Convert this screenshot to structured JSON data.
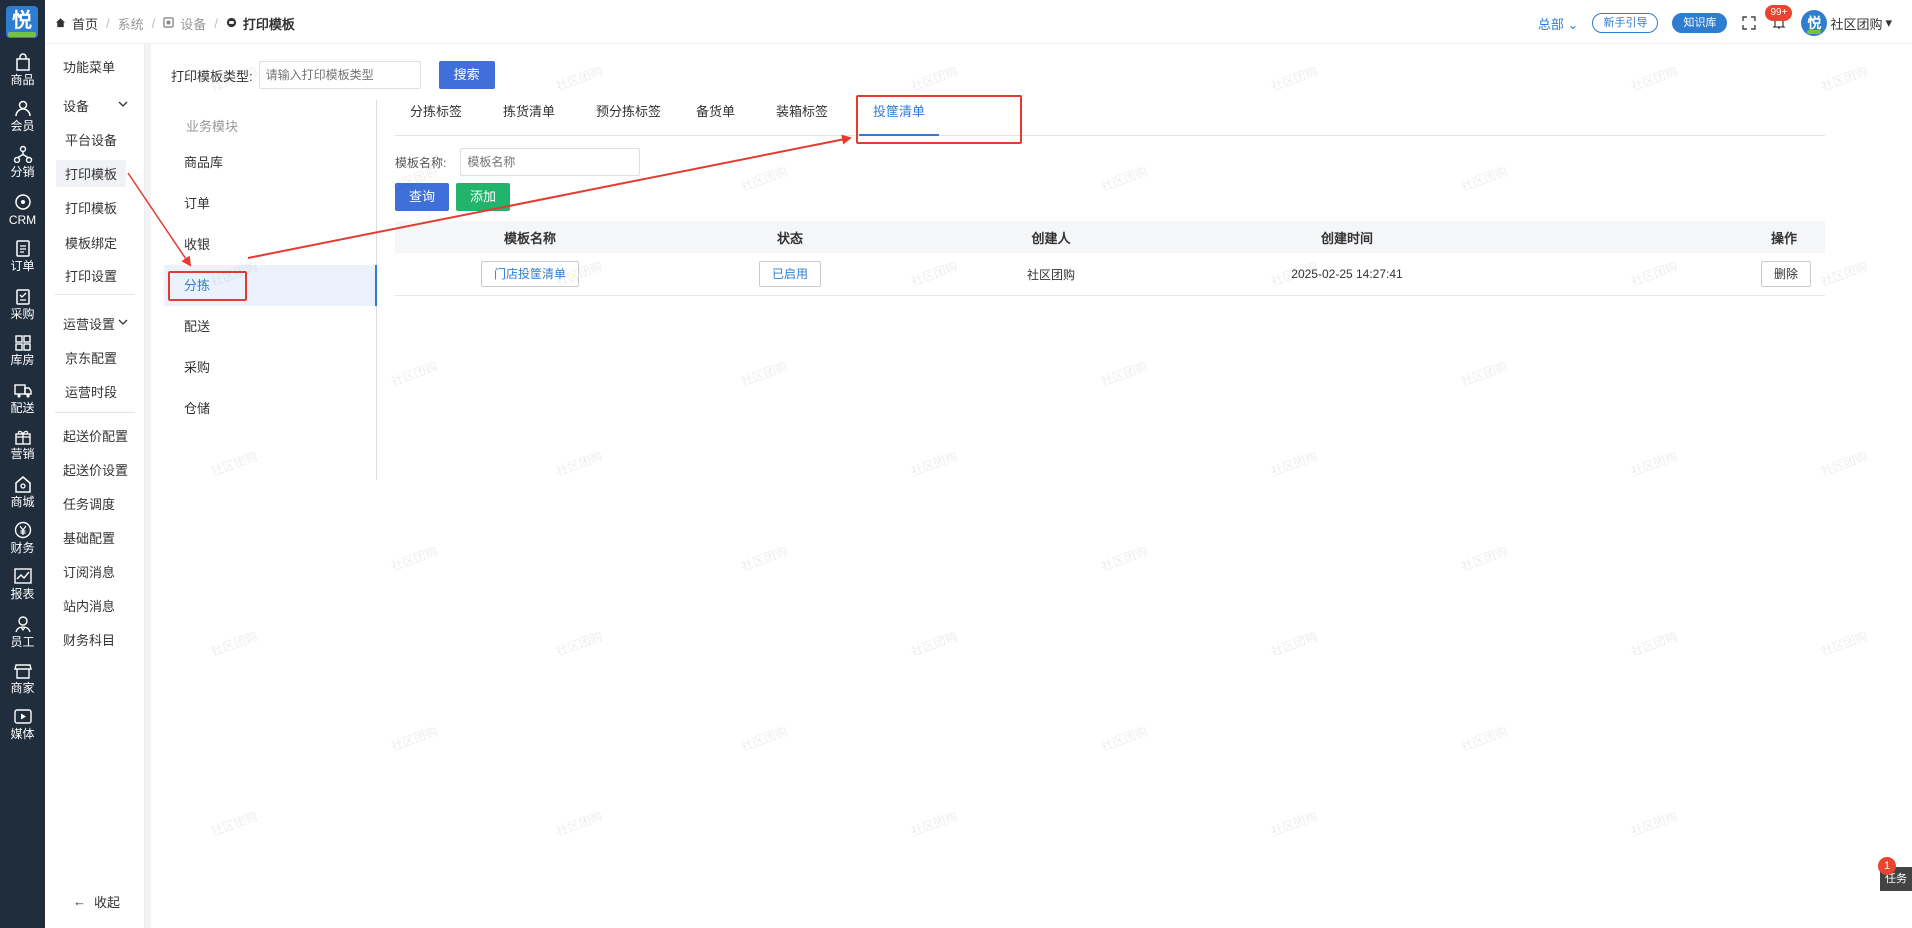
{
  "rail": {
    "logo": "悦",
    "items": [
      {
        "label": "商品",
        "icon": "bag-icon"
      },
      {
        "label": "会员",
        "icon": "user-icon"
      },
      {
        "label": "分销",
        "icon": "network-icon"
      },
      {
        "label": "CRM",
        "icon": "crm-icon"
      },
      {
        "label": "订单",
        "icon": "order-icon"
      },
      {
        "label": "采购",
        "icon": "clipboard-icon"
      },
      {
        "label": "库房",
        "icon": "grid-icon"
      },
      {
        "label": "配送",
        "icon": "truck-icon"
      },
      {
        "label": "营销",
        "icon": "gift-icon"
      },
      {
        "label": "商城",
        "icon": "shop-icon"
      },
      {
        "label": "财务",
        "icon": "yen-icon"
      },
      {
        "label": "报表",
        "icon": "chart-icon"
      },
      {
        "label": "员工",
        "icon": "staff-icon"
      },
      {
        "label": "商家",
        "icon": "store-icon"
      },
      {
        "label": "媒体",
        "icon": "play-icon"
      }
    ]
  },
  "breadcrumb": {
    "home": "首页",
    "system": "系统",
    "device": "设备",
    "current": "打印模板"
  },
  "header": {
    "org": "总部",
    "guide": "新手引导",
    "kb": "知识库",
    "notify_count": "99+",
    "user": "社区团购",
    "avatar_text": "悦"
  },
  "submenu": {
    "func_menu": "功能菜单",
    "device": "设备",
    "items_device": [
      "平台设备",
      "打印模板",
      "打印模板",
      "模板绑定",
      "打印设置"
    ],
    "ops": "运营设置",
    "items_ops": [
      "京东配置",
      "运营时段"
    ],
    "items_more": [
      "起送价配置",
      "起送价设置",
      "任务调度",
      "基础配置",
      "订阅消息",
      "站内消息",
      "财务科目"
    ],
    "collapse": "收起"
  },
  "search": {
    "label": "打印模板类型:",
    "placeholder": "请输入打印模板类型",
    "button": "搜索"
  },
  "modules": {
    "title": "业务模块",
    "items": [
      "商品库",
      "订单",
      "收银",
      "分拣",
      "配送",
      "采购",
      "仓储"
    ]
  },
  "tabs": [
    "分拣标签",
    "拣货清单",
    "预分拣标签",
    "备货单",
    "装箱标签",
    "投筐清单"
  ],
  "filter": {
    "label": "模板名称:",
    "placeholder": "模板名称",
    "query": "查询",
    "add": "添加"
  },
  "table": {
    "headers": [
      "模板名称",
      "状态",
      "创建人",
      "创建时间",
      "操作"
    ],
    "rows": [
      {
        "name": "门店投筐清单",
        "status": "已启用",
        "creator": "社区团购",
        "time": "2025-02-25 14:27:41",
        "action": "删除"
      }
    ]
  },
  "watermark": "社区团购",
  "task": {
    "label": "任务",
    "count": "1"
  }
}
